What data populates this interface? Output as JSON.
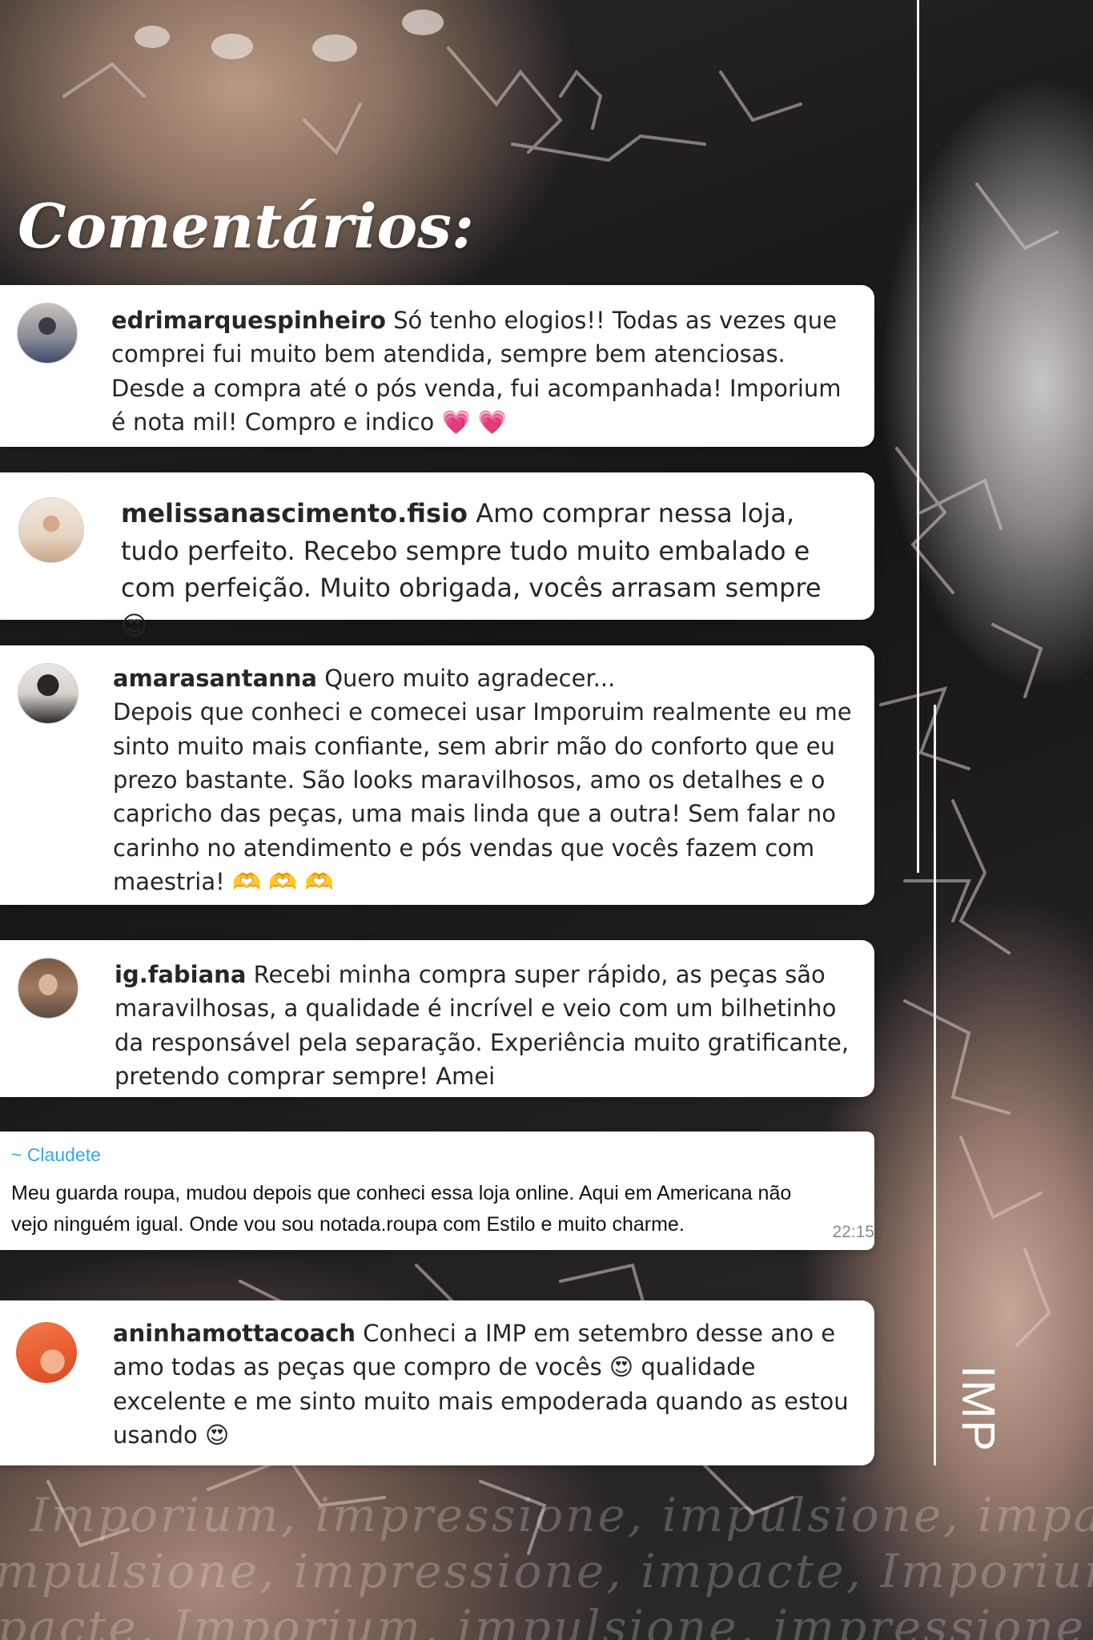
{
  "heading": "Comentários:",
  "comments": [
    {
      "username": "edrimarquespinheiro",
      "text": "Só tenho elogios!! Todas as vezes que comprei fui muito bem atendida, sempre bem atenciosas. Desde a compra até o pós venda, fui acompanhada! Imporium é nota mil! Compro e indico",
      "emoji": "💗 💗"
    },
    {
      "username": "melissanascimento.fisio",
      "text": "Amo comprar nessa loja, tudo perfeito. Recebo sempre tudo muito embalado e com perfeição. Muito obrigada, vocês arrasam sempre",
      "emoji": "😍"
    },
    {
      "username": "amarasantanna",
      "text": "Quero muito agradecer...",
      "text2": "Depois que conheci e comecei usar Imporuim realmente eu me sinto muito mais confiante, sem abrir mão do conforto que eu prezo bastante. São looks maravilhosos, amo os detalhes e o capricho das peças, uma mais linda que a outra! Sem falar no carinho no atendimento e pós vendas que vocês fazem com maestria!",
      "emoji": "🫶 🫶 🫶"
    },
    {
      "username": "ig.fabiana",
      "text": "Recebi minha compra super rápido, as peças são maravilhosas, a qualidade é incrível e veio com um bilhetinho da responsável pela separação. Experiência muito gratificante, pretendo comprar sempre! Amei"
    },
    {
      "username": "~ Claudete",
      "text": "Meu guarda roupa, mudou depois que conheci essa loja online. Aqui em Americana não vejo ninguém igual. Onde vou sou notada.roupa com Estilo e muito charme.",
      "time": "22:15"
    },
    {
      "username": "aninhamottacoach",
      "text_a": "Conheci a IMP em setembro desse ano e amo todas as peças que compro de vocês",
      "emoji_a": "😍",
      "text_b": "qualidade excelente e me sinto muito mais empoderada quando as estou usando",
      "emoji_b": "😍"
    }
  ],
  "brand": "IMP",
  "tagline_lines": [
    "Imporium, impressione, impulsione, impacte,",
    "mpulsione, impressione, impacte, Imporium,",
    "pacte, Imporium, impulsione, impressione, I"
  ],
  "colors": {
    "card": "#ffffff",
    "whatsapp_name": "#35a8e0",
    "heart": "#e8326b"
  }
}
